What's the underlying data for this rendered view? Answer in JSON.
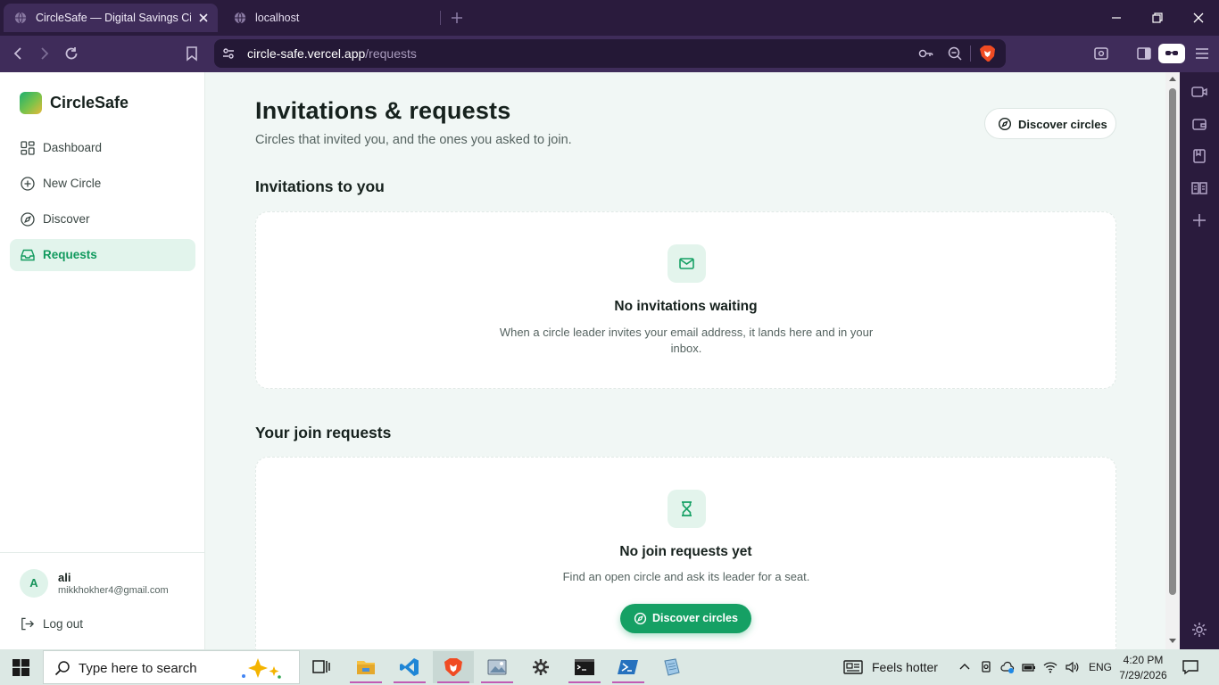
{
  "browser": {
    "tabs": [
      {
        "title": "CircleSafe — Digital Savings Circ",
        "active": true
      },
      {
        "title": "localhost",
        "active": false
      }
    ],
    "url": {
      "host": "circle-safe.vercel.app",
      "path": "/requests"
    }
  },
  "sidebar": {
    "brand": "CircleSafe",
    "items": [
      {
        "label": "Dashboard",
        "icon": "grid-icon"
      },
      {
        "label": "New Circle",
        "icon": "plus-circle-icon"
      },
      {
        "label": "Discover",
        "icon": "compass-icon"
      },
      {
        "label": "Requests",
        "icon": "inbox-icon",
        "active": true
      }
    ],
    "user": {
      "initial": "A",
      "name": "ali",
      "email": "mikkhokher4@gmail.com"
    },
    "logout_label": "Log out"
  },
  "main": {
    "title": "Invitations & requests",
    "subtitle": "Circles that invited you, and the ones you asked to join.",
    "discover_button": "Discover circles",
    "invitations": {
      "heading": "Invitations to you",
      "empty_title": "No invitations waiting",
      "empty_desc": "When a circle leader invites your email address, it lands here and in your inbox."
    },
    "join_requests": {
      "heading": "Your join requests",
      "empty_title": "No join requests yet",
      "empty_desc": "Find an open circle and ask its leader for a seat.",
      "cta": "Discover circles"
    }
  },
  "taskbar": {
    "search_placeholder": "Type here to search",
    "weather": "Feels hotter",
    "lang": "ENG",
    "time": "4:20 PM",
    "date": "7/29/2026"
  },
  "colors": {
    "accent": "#15a064",
    "browser_bg": "#3f2c5a",
    "page_bg": "#f1f7f5"
  }
}
